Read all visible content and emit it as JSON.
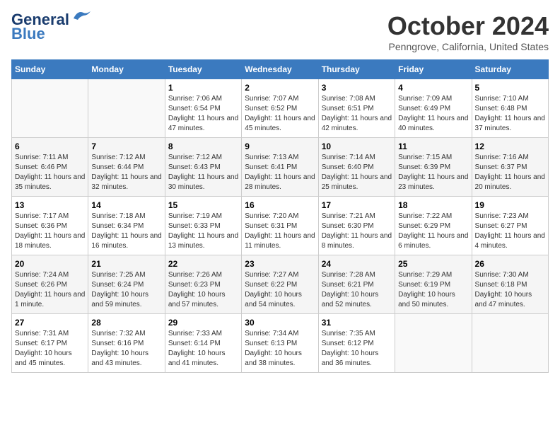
{
  "header": {
    "logo_line1": "General",
    "logo_line2": "Blue",
    "month": "October 2024",
    "location": "Penngrove, California, United States"
  },
  "weekdays": [
    "Sunday",
    "Monday",
    "Tuesday",
    "Wednesday",
    "Thursday",
    "Friday",
    "Saturday"
  ],
  "weeks": [
    [
      {
        "day": "",
        "sunrise": "",
        "sunset": "",
        "daylight": ""
      },
      {
        "day": "",
        "sunrise": "",
        "sunset": "",
        "daylight": ""
      },
      {
        "day": "1",
        "sunrise": "Sunrise: 7:06 AM",
        "sunset": "Sunset: 6:54 PM",
        "daylight": "Daylight: 11 hours and 47 minutes."
      },
      {
        "day": "2",
        "sunrise": "Sunrise: 7:07 AM",
        "sunset": "Sunset: 6:52 PM",
        "daylight": "Daylight: 11 hours and 45 minutes."
      },
      {
        "day": "3",
        "sunrise": "Sunrise: 7:08 AM",
        "sunset": "Sunset: 6:51 PM",
        "daylight": "Daylight: 11 hours and 42 minutes."
      },
      {
        "day": "4",
        "sunrise": "Sunrise: 7:09 AM",
        "sunset": "Sunset: 6:49 PM",
        "daylight": "Daylight: 11 hours and 40 minutes."
      },
      {
        "day": "5",
        "sunrise": "Sunrise: 7:10 AM",
        "sunset": "Sunset: 6:48 PM",
        "daylight": "Daylight: 11 hours and 37 minutes."
      }
    ],
    [
      {
        "day": "6",
        "sunrise": "Sunrise: 7:11 AM",
        "sunset": "Sunset: 6:46 PM",
        "daylight": "Daylight: 11 hours and 35 minutes."
      },
      {
        "day": "7",
        "sunrise": "Sunrise: 7:12 AM",
        "sunset": "Sunset: 6:44 PM",
        "daylight": "Daylight: 11 hours and 32 minutes."
      },
      {
        "day": "8",
        "sunrise": "Sunrise: 7:12 AM",
        "sunset": "Sunset: 6:43 PM",
        "daylight": "Daylight: 11 hours and 30 minutes."
      },
      {
        "day": "9",
        "sunrise": "Sunrise: 7:13 AM",
        "sunset": "Sunset: 6:41 PM",
        "daylight": "Daylight: 11 hours and 28 minutes."
      },
      {
        "day": "10",
        "sunrise": "Sunrise: 7:14 AM",
        "sunset": "Sunset: 6:40 PM",
        "daylight": "Daylight: 11 hours and 25 minutes."
      },
      {
        "day": "11",
        "sunrise": "Sunrise: 7:15 AM",
        "sunset": "Sunset: 6:39 PM",
        "daylight": "Daylight: 11 hours and 23 minutes."
      },
      {
        "day": "12",
        "sunrise": "Sunrise: 7:16 AM",
        "sunset": "Sunset: 6:37 PM",
        "daylight": "Daylight: 11 hours and 20 minutes."
      }
    ],
    [
      {
        "day": "13",
        "sunrise": "Sunrise: 7:17 AM",
        "sunset": "Sunset: 6:36 PM",
        "daylight": "Daylight: 11 hours and 18 minutes."
      },
      {
        "day": "14",
        "sunrise": "Sunrise: 7:18 AM",
        "sunset": "Sunset: 6:34 PM",
        "daylight": "Daylight: 11 hours and 16 minutes."
      },
      {
        "day": "15",
        "sunrise": "Sunrise: 7:19 AM",
        "sunset": "Sunset: 6:33 PM",
        "daylight": "Daylight: 11 hours and 13 minutes."
      },
      {
        "day": "16",
        "sunrise": "Sunrise: 7:20 AM",
        "sunset": "Sunset: 6:31 PM",
        "daylight": "Daylight: 11 hours and 11 minutes."
      },
      {
        "day": "17",
        "sunrise": "Sunrise: 7:21 AM",
        "sunset": "Sunset: 6:30 PM",
        "daylight": "Daylight: 11 hours and 8 minutes."
      },
      {
        "day": "18",
        "sunrise": "Sunrise: 7:22 AM",
        "sunset": "Sunset: 6:29 PM",
        "daylight": "Daylight: 11 hours and 6 minutes."
      },
      {
        "day": "19",
        "sunrise": "Sunrise: 7:23 AM",
        "sunset": "Sunset: 6:27 PM",
        "daylight": "Daylight: 11 hours and 4 minutes."
      }
    ],
    [
      {
        "day": "20",
        "sunrise": "Sunrise: 7:24 AM",
        "sunset": "Sunset: 6:26 PM",
        "daylight": "Daylight: 11 hours and 1 minute."
      },
      {
        "day": "21",
        "sunrise": "Sunrise: 7:25 AM",
        "sunset": "Sunset: 6:24 PM",
        "daylight": "Daylight: 10 hours and 59 minutes."
      },
      {
        "day": "22",
        "sunrise": "Sunrise: 7:26 AM",
        "sunset": "Sunset: 6:23 PM",
        "daylight": "Daylight: 10 hours and 57 minutes."
      },
      {
        "day": "23",
        "sunrise": "Sunrise: 7:27 AM",
        "sunset": "Sunset: 6:22 PM",
        "daylight": "Daylight: 10 hours and 54 minutes."
      },
      {
        "day": "24",
        "sunrise": "Sunrise: 7:28 AM",
        "sunset": "Sunset: 6:21 PM",
        "daylight": "Daylight: 10 hours and 52 minutes."
      },
      {
        "day": "25",
        "sunrise": "Sunrise: 7:29 AM",
        "sunset": "Sunset: 6:19 PM",
        "daylight": "Daylight: 10 hours and 50 minutes."
      },
      {
        "day": "26",
        "sunrise": "Sunrise: 7:30 AM",
        "sunset": "Sunset: 6:18 PM",
        "daylight": "Daylight: 10 hours and 47 minutes."
      }
    ],
    [
      {
        "day": "27",
        "sunrise": "Sunrise: 7:31 AM",
        "sunset": "Sunset: 6:17 PM",
        "daylight": "Daylight: 10 hours and 45 minutes."
      },
      {
        "day": "28",
        "sunrise": "Sunrise: 7:32 AM",
        "sunset": "Sunset: 6:16 PM",
        "daylight": "Daylight: 10 hours and 43 minutes."
      },
      {
        "day": "29",
        "sunrise": "Sunrise: 7:33 AM",
        "sunset": "Sunset: 6:14 PM",
        "daylight": "Daylight: 10 hours and 41 minutes."
      },
      {
        "day": "30",
        "sunrise": "Sunrise: 7:34 AM",
        "sunset": "Sunset: 6:13 PM",
        "daylight": "Daylight: 10 hours and 38 minutes."
      },
      {
        "day": "31",
        "sunrise": "Sunrise: 7:35 AM",
        "sunset": "Sunset: 6:12 PM",
        "daylight": "Daylight: 10 hours and 36 minutes."
      },
      {
        "day": "",
        "sunrise": "",
        "sunset": "",
        "daylight": ""
      },
      {
        "day": "",
        "sunrise": "",
        "sunset": "",
        "daylight": ""
      }
    ]
  ]
}
